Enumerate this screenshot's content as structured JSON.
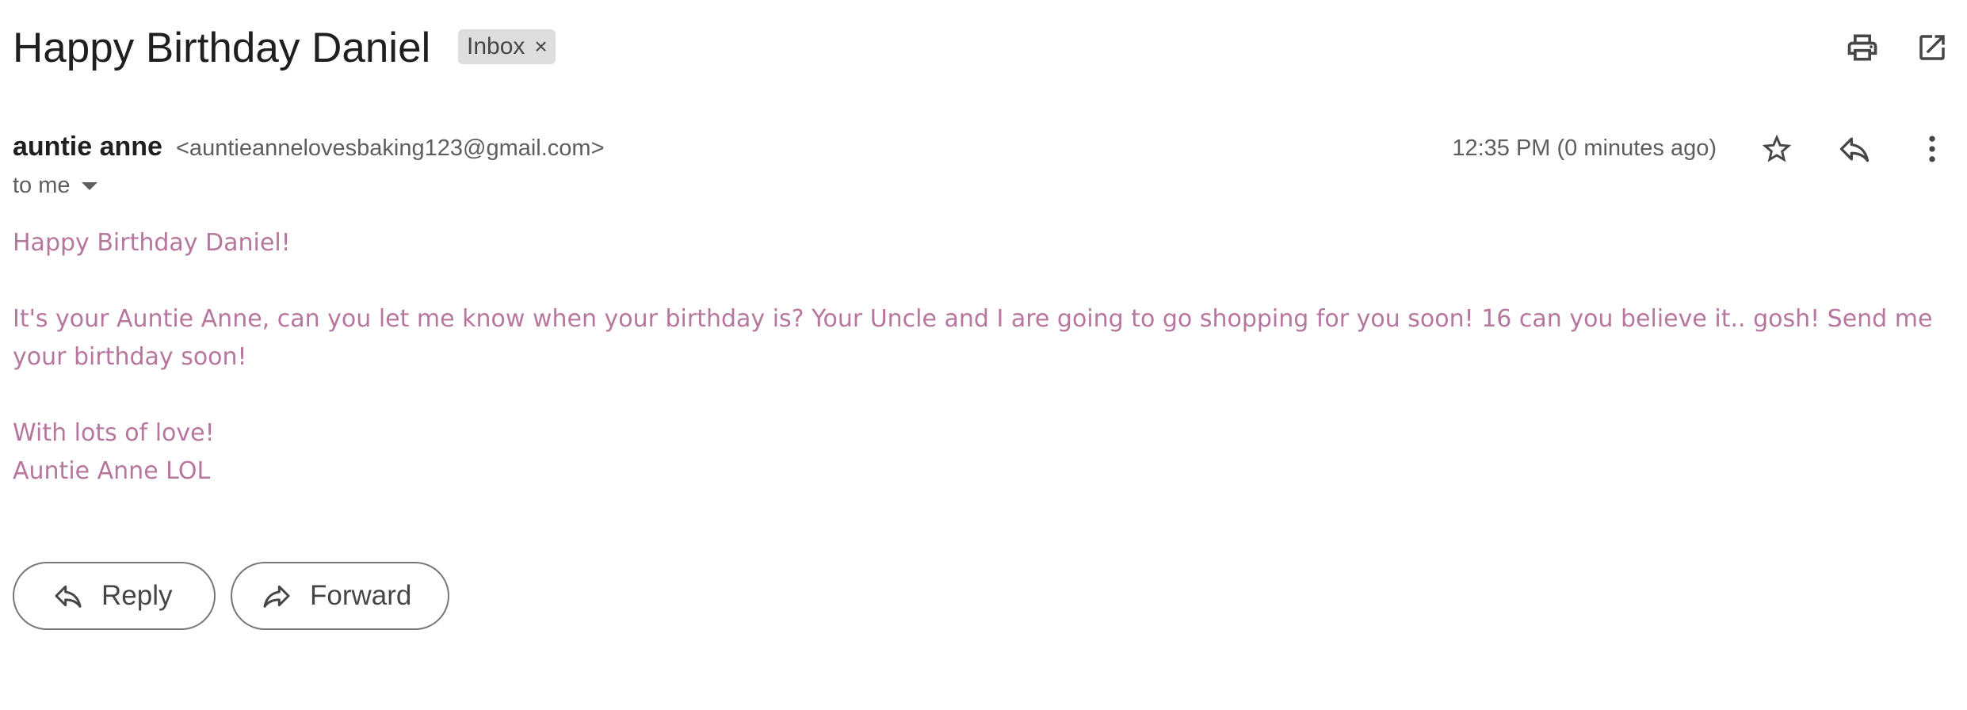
{
  "message": {
    "subject": "Happy Birthday Daniel",
    "label": "Inbox",
    "label_remove": "×",
    "sender_name": "auntie anne",
    "sender_email": "<auntieannelovesbaking123@gmail.com>",
    "recipient": "to me",
    "time": "12:35 PM (0 minutes ago)",
    "body": {
      "greeting": "Happy Birthday Daniel!",
      "paragraph": "It's your Auntie Anne, can you let me know when your birthday is? Your Uncle and I are going to go shopping for you soon! 16 can you believe it.. gosh! Send me your birthday soon!",
      "closing": "With lots of love!",
      "signature": "Auntie Anne LOL"
    }
  },
  "actions": {
    "reply_label": "Reply",
    "forward_label": "Forward"
  },
  "icons": {
    "print": "print-icon",
    "open_new_window": "open-in-new-window-icon",
    "star": "star-icon",
    "reply": "reply-icon",
    "more": "more-vertical-icon",
    "forward": "forward-icon"
  },
  "colors": {
    "body_text": "#b6769d",
    "label_chip_bg": "#dddddd",
    "button_border": "#747775"
  }
}
